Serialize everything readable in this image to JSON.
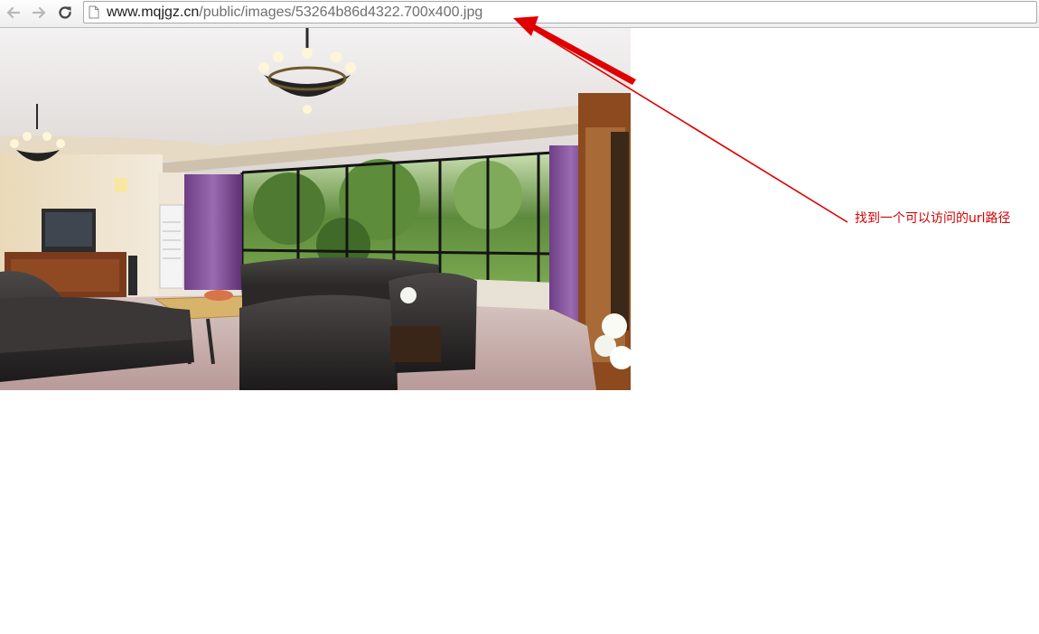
{
  "browser": {
    "url_host": "www.mqjgz.cn",
    "url_path": "/public/images/53264b86d4322.700x400.jpg",
    "nav_icons": [
      "back-arrow-icon",
      "forward-arrow-icon",
      "reload-icon",
      "page-icon"
    ]
  },
  "content": {
    "image_subject": "living-room-photo"
  },
  "annotation": {
    "text": "找到一个可以访问的url路径",
    "color": "#d40000"
  }
}
